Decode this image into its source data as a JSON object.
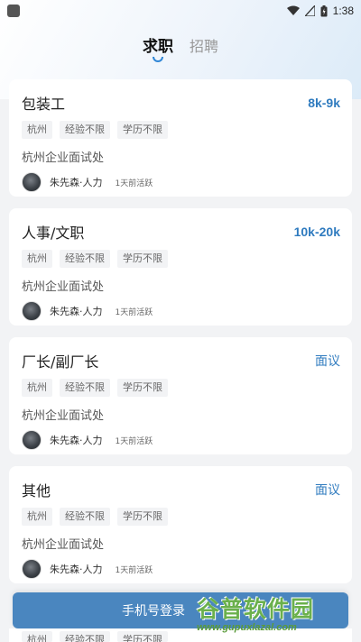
{
  "status_bar": {
    "time": "1:38"
  },
  "tabs": [
    {
      "label": "求职",
      "active": true
    },
    {
      "label": "招聘",
      "active": false
    }
  ],
  "jobs": [
    {
      "title": "包装工",
      "salary": "8k-9k",
      "tags": [
        "杭州",
        "经验不限",
        "学历不限"
      ],
      "company": "杭州企业面试处",
      "recruiter": "朱先森·人力",
      "active": "1天前活跃"
    },
    {
      "title": "人事/文职",
      "salary": "10k-20k",
      "tags": [
        "杭州",
        "经验不限",
        "学历不限"
      ],
      "company": "杭州企业面试处",
      "recruiter": "朱先森·人力",
      "active": "1天前活跃"
    },
    {
      "title": "厂长/副厂长",
      "salary": "面议",
      "tags": [
        "杭州",
        "经验不限",
        "学历不限"
      ],
      "company": "杭州企业面试处",
      "recruiter": "朱先森·人力",
      "active": "1天前活跃"
    },
    {
      "title": "其他",
      "salary": "面议",
      "tags": [
        "杭州",
        "经验不限",
        "学历不限"
      ],
      "company": "杭州企业面试处",
      "recruiter": "朱先森·人力",
      "active": "1天前活跃"
    }
  ],
  "login_bar": {
    "label": "手机号登录"
  },
  "partial_card": {
    "tags": [
      "杭州",
      "经验不限",
      "学历不限"
    ]
  },
  "watermark": {
    "name": "谷普软件园",
    "url": "www.gupuxlazal.com"
  },
  "colors": {
    "accent": "#2f7bbf",
    "login_bg": "#4a86bf",
    "background": "#f2f3f5"
  }
}
